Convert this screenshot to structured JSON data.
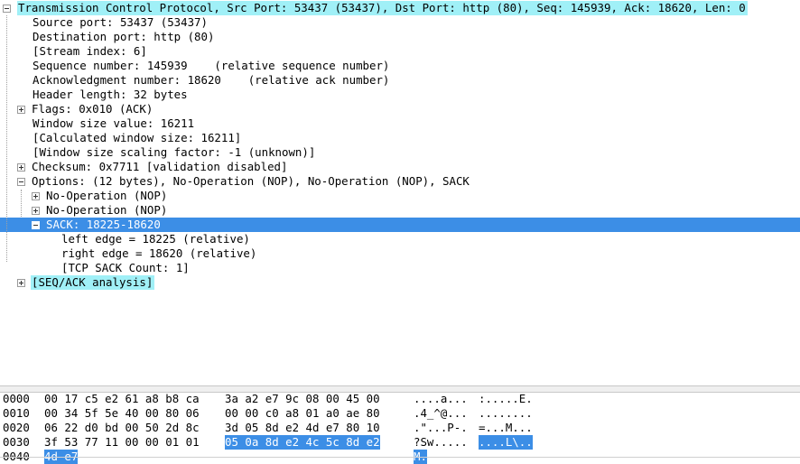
{
  "tree": {
    "rows": [
      {
        "text": "Transmission Control Protocol, Src Port: 53437 (53437), Dst Port: http (80), Seq: 145939, Ack: 18620, Len: 0",
        "indent": 0,
        "toggle": "expanded",
        "style": "cyan"
      },
      {
        "text": "Source port: 53437 (53437)",
        "indent": 1,
        "toggle": "none",
        "style": "normal"
      },
      {
        "text": "Destination port: http (80)",
        "indent": 1,
        "toggle": "none",
        "style": "normal"
      },
      {
        "text": "[Stream index: 6]",
        "indent": 1,
        "toggle": "none",
        "style": "normal"
      },
      {
        "text": "Sequence number: 145939    (relative sequence number)",
        "indent": 1,
        "toggle": "none",
        "style": "normal"
      },
      {
        "text": "Acknowledgment number: 18620    (relative ack number)",
        "indent": 1,
        "toggle": "none",
        "style": "normal"
      },
      {
        "text": "Header length: 32 bytes",
        "indent": 1,
        "toggle": "none",
        "style": "normal"
      },
      {
        "text": "Flags: 0x010 (ACK)",
        "indent": 1,
        "toggle": "collapsed",
        "style": "normal"
      },
      {
        "text": "Window size value: 16211",
        "indent": 1,
        "toggle": "none",
        "style": "normal"
      },
      {
        "text": "[Calculated window size: 16211]",
        "indent": 1,
        "toggle": "none",
        "style": "normal"
      },
      {
        "text": "[Window size scaling factor: -1 (unknown)]",
        "indent": 1,
        "toggle": "none",
        "style": "normal"
      },
      {
        "text": "Checksum: 0x7711 [validation disabled]",
        "indent": 1,
        "toggle": "collapsed",
        "style": "normal"
      },
      {
        "text": "Options: (12 bytes), No-Operation (NOP), No-Operation (NOP), SACK",
        "indent": 1,
        "toggle": "expanded",
        "style": "normal"
      },
      {
        "text": "No-Operation (NOP)",
        "indent": 2,
        "toggle": "collapsed",
        "style": "normal"
      },
      {
        "text": "No-Operation (NOP)",
        "indent": 2,
        "toggle": "collapsed",
        "style": "normal"
      },
      {
        "text": "SACK: 18225-18620",
        "indent": 2,
        "toggle": "expanded",
        "style": "selected"
      },
      {
        "text": "left edge = 18225 (relative)",
        "indent": 3,
        "toggle": "none",
        "style": "normal"
      },
      {
        "text": "right edge = 18620 (relative)",
        "indent": 3,
        "toggle": "none",
        "style": "normal"
      },
      {
        "text": "[TCP SACK Count: 1]",
        "indent": 3,
        "toggle": "none",
        "style": "normal"
      },
      {
        "text": "[SEQ/ACK analysis]",
        "indent": 1,
        "toggle": "collapsed",
        "style": "cyan"
      }
    ]
  },
  "hex": {
    "rows": [
      {
        "offset": "0000",
        "bytes_a": "00 17 c5 e2 61 a8 b8 ca",
        "sel_a": "",
        "bytes_b": "3a a2 e7 9c 08 00 45 00",
        "sel_b": "",
        "ascii_a": "....a...",
        "sel_ascii_a": "",
        "ascii_b": ":.....E.",
        "sel_ascii_b": ""
      },
      {
        "offset": "0010",
        "bytes_a": "00 34 5f 5e 40 00 80 06",
        "sel_a": "",
        "bytes_b": "00 00 c0 a8 01 a0 ae 80",
        "sel_b": "",
        "ascii_a": ".4_^@...",
        "sel_ascii_a": "",
        "ascii_b": "........",
        "sel_ascii_b": ""
      },
      {
        "offset": "0020",
        "bytes_a": "06 22 d0 bd 00 50 2d 8c",
        "sel_a": "",
        "bytes_b": "3d 05 8d e2 4d e7 80 10",
        "sel_b": "",
        "ascii_a": ".\"...P-.",
        "sel_ascii_a": "",
        "ascii_b": "=...M...",
        "sel_ascii_b": ""
      },
      {
        "offset": "0030",
        "bytes_a": "3f 53 77 11 00 00 01 01",
        "sel_a": "",
        "bytes_b": "",
        "sel_b": "05 0a 8d e2 4c 5c 8d e2",
        "ascii_a": "?Sw.....",
        "sel_ascii_a": "",
        "ascii_b": "",
        "sel_ascii_b": "....L\\.."
      },
      {
        "offset": "0040",
        "bytes_a": "",
        "sel_a": "4d e7",
        "bytes_b": "",
        "sel_b": "",
        "ascii_a": "",
        "sel_ascii_a": "M.",
        "ascii_b": "",
        "sel_ascii_b": ""
      }
    ]
  }
}
